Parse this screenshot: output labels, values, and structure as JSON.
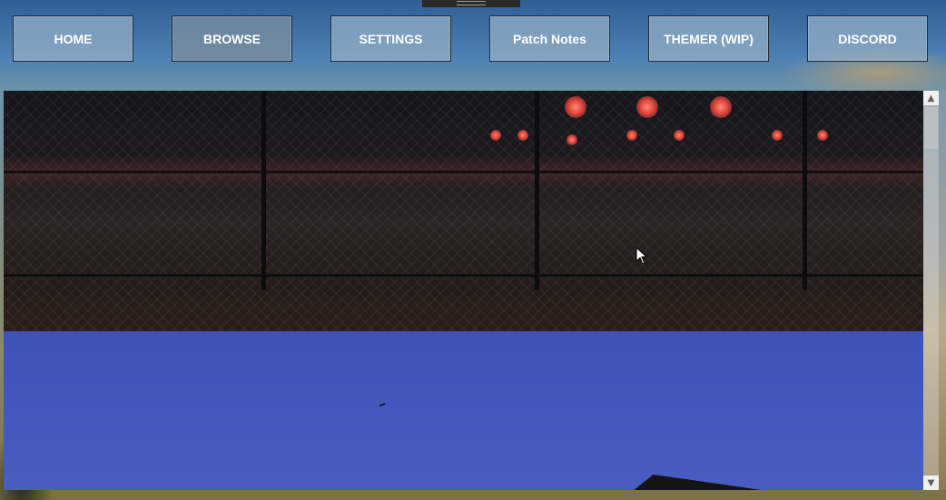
{
  "nav": {
    "buttons": [
      {
        "label": "HOME"
      },
      {
        "label": "BROWSE"
      },
      {
        "label": "SETTINGS"
      },
      {
        "label": "Patch Notes"
      },
      {
        "label": "THEMER (WIP)"
      },
      {
        "label": "DISCORD"
      }
    ],
    "active_index": 1
  },
  "gallery": {
    "images": [
      {
        "icon": "night-airfield-image"
      },
      {
        "icon": "blue-sky-image"
      }
    ]
  },
  "scrollbar": {
    "up_icon": "arrow-up-icon",
    "down_icon": "arrow-down-icon"
  },
  "colors": {
    "button_bg": "#96afc6",
    "button_text": "#ffffff",
    "sky_blue": "#4458bf"
  }
}
